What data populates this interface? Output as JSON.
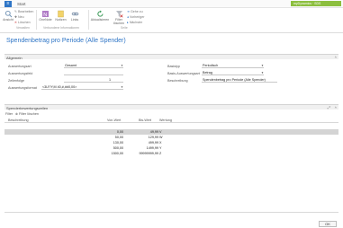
{
  "titlebar": {
    "app_glyph": "≡",
    "tab": "Start",
    "right_label": "myDynamics · SDS"
  },
  "ribbon": {
    "ansicht": "Ansicht",
    "bearbeiten": "Bearbeiten",
    "neu": "Neu",
    "loeschen": "Löschen",
    "group_verwalten": "Verwalten",
    "onenote": "OneNote",
    "notizen": "Notizen",
    "links": "Links",
    "group_verbundene": "Verbundene Informationen",
    "aktualisieren": "Aktualisieren",
    "filter_loeschen": "Filter löschen",
    "gehe_zu": "Gehe zu",
    "vorheriger": "Vorheriger",
    "naechster": "Nächster",
    "group_seite": "Seite"
  },
  "page_title": "Spendenbetrag pro Periode (Alle Spender)",
  "allgemein": {
    "tab_label": "Allgemein",
    "auswertungsart_label": "Auswertungsart",
    "auswertungsart_value": "Gesamt",
    "auswertungsfeld_label": "Auswertungsfeld",
    "auswertungsfeld_value": "",
    "zeilenfolge_label": "Zeilenfolge",
    "zeilenfolge_value": "1",
    "auswertungsformat_label": "Auswertungsformat",
    "auswertungsformat_value": "<3LF/Y,M 40,#,##0,00>",
    "basistyp_label": "Basistyp",
    "basistyp_value": "Periodisch",
    "basis_auswertungsart_label": "Basis-Auswertungsart",
    "basis_auswertungsart_value": "Betrag",
    "beschreibung_label": "Beschreibung",
    "beschreibung_value": "Spendenbetrag pro Periode (Alle Spender)"
  },
  "lines": {
    "tab_label": "Spenderbewertungszeilen",
    "tools": {
      "filter": "Filter",
      "filter_loeschen": "Filter löschen"
    },
    "columns": [
      "Beschreibung",
      "Von-Wert",
      "Bis-Wert",
      "Wertung"
    ],
    "rows": [
      {
        "beschreibung": "",
        "von": "0,00",
        "bis": "49,99",
        "wertung": "V"
      },
      {
        "beschreibung": "",
        "von": "50,00",
        "bis": "129,99",
        "wertung": "W"
      },
      {
        "beschreibung": "",
        "von": "130,00",
        "bis": "499,99",
        "wertung": "X"
      },
      {
        "beschreibung": "",
        "von": "500,00",
        "bis": "1499,99",
        "wertung": "Y"
      },
      {
        "beschreibung": "",
        "von": "1500,00",
        "bis": "99999999,99",
        "wertung": "Z"
      }
    ]
  },
  "ok_button": "OK",
  "colors": {
    "accent": "#2e75c6",
    "title_right_bg": "#8cbf3f",
    "selected_row": "#d4d4d4"
  }
}
